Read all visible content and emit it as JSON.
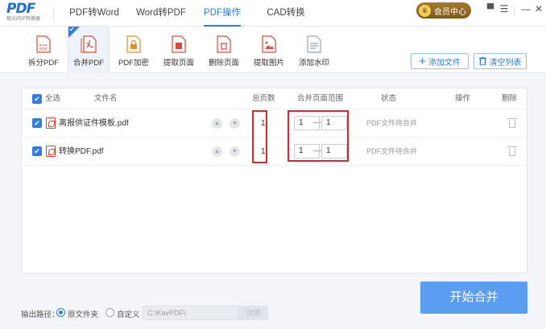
{
  "logo": {
    "mark": "PDF",
    "subtitle": "极光PDF转换器"
  },
  "nav": {
    "tabs": [
      {
        "label": "PDF转Word",
        "active": false
      },
      {
        "label": "Word转PDF",
        "active": false
      },
      {
        "label": "PDF操作",
        "active": true
      },
      {
        "label": "CAD转换",
        "active": false
      }
    ]
  },
  "vip": {
    "label": "会员中心"
  },
  "window": {
    "skin": "▀",
    "menu": "☰",
    "minimize": "—",
    "close": "✕"
  },
  "toolbar": {
    "tools": [
      {
        "label": "拆分PDF",
        "icon": "split-pdf-icon"
      },
      {
        "label": "合并PDF",
        "icon": "merge-pdf-icon",
        "active": true
      },
      {
        "label": "PDF加密",
        "icon": "lock-pdf-icon"
      },
      {
        "label": "提取页面",
        "icon": "extract-page-icon"
      },
      {
        "label": "删除页面",
        "icon": "delete-page-icon"
      },
      {
        "label": "提取图片",
        "icon": "extract-image-icon"
      },
      {
        "label": "添加水印",
        "icon": "watermark-icon"
      }
    ],
    "add_file": "添加文件",
    "clear_list": "清空列表"
  },
  "table": {
    "headers": {
      "select_all": "全选",
      "filename": "文件名",
      "total_pages": "总页数",
      "range": "合并页面范围",
      "status": "状态",
      "action": "操作",
      "delete": "删除"
    },
    "rows": [
      {
        "filename": "离报供证件模板.pdf",
        "pages": "1",
        "from": "1",
        "to": "1",
        "status": "PDF文件待合并"
      },
      {
        "filename": "转换PDF.pdf",
        "pages": "1",
        "from": "1",
        "to": "1",
        "status": "PDF文件待合并"
      }
    ]
  },
  "footer": {
    "output_label": "输出路径：",
    "option_original": "原文件夹",
    "option_custom": "自定义",
    "path": "C:\\KavPDF\\",
    "browse": "浏览",
    "start": "开始合并"
  },
  "colors": {
    "accent": "#2f7de1",
    "highlight": "#e2242c",
    "start_button": "#5b9df1"
  }
}
